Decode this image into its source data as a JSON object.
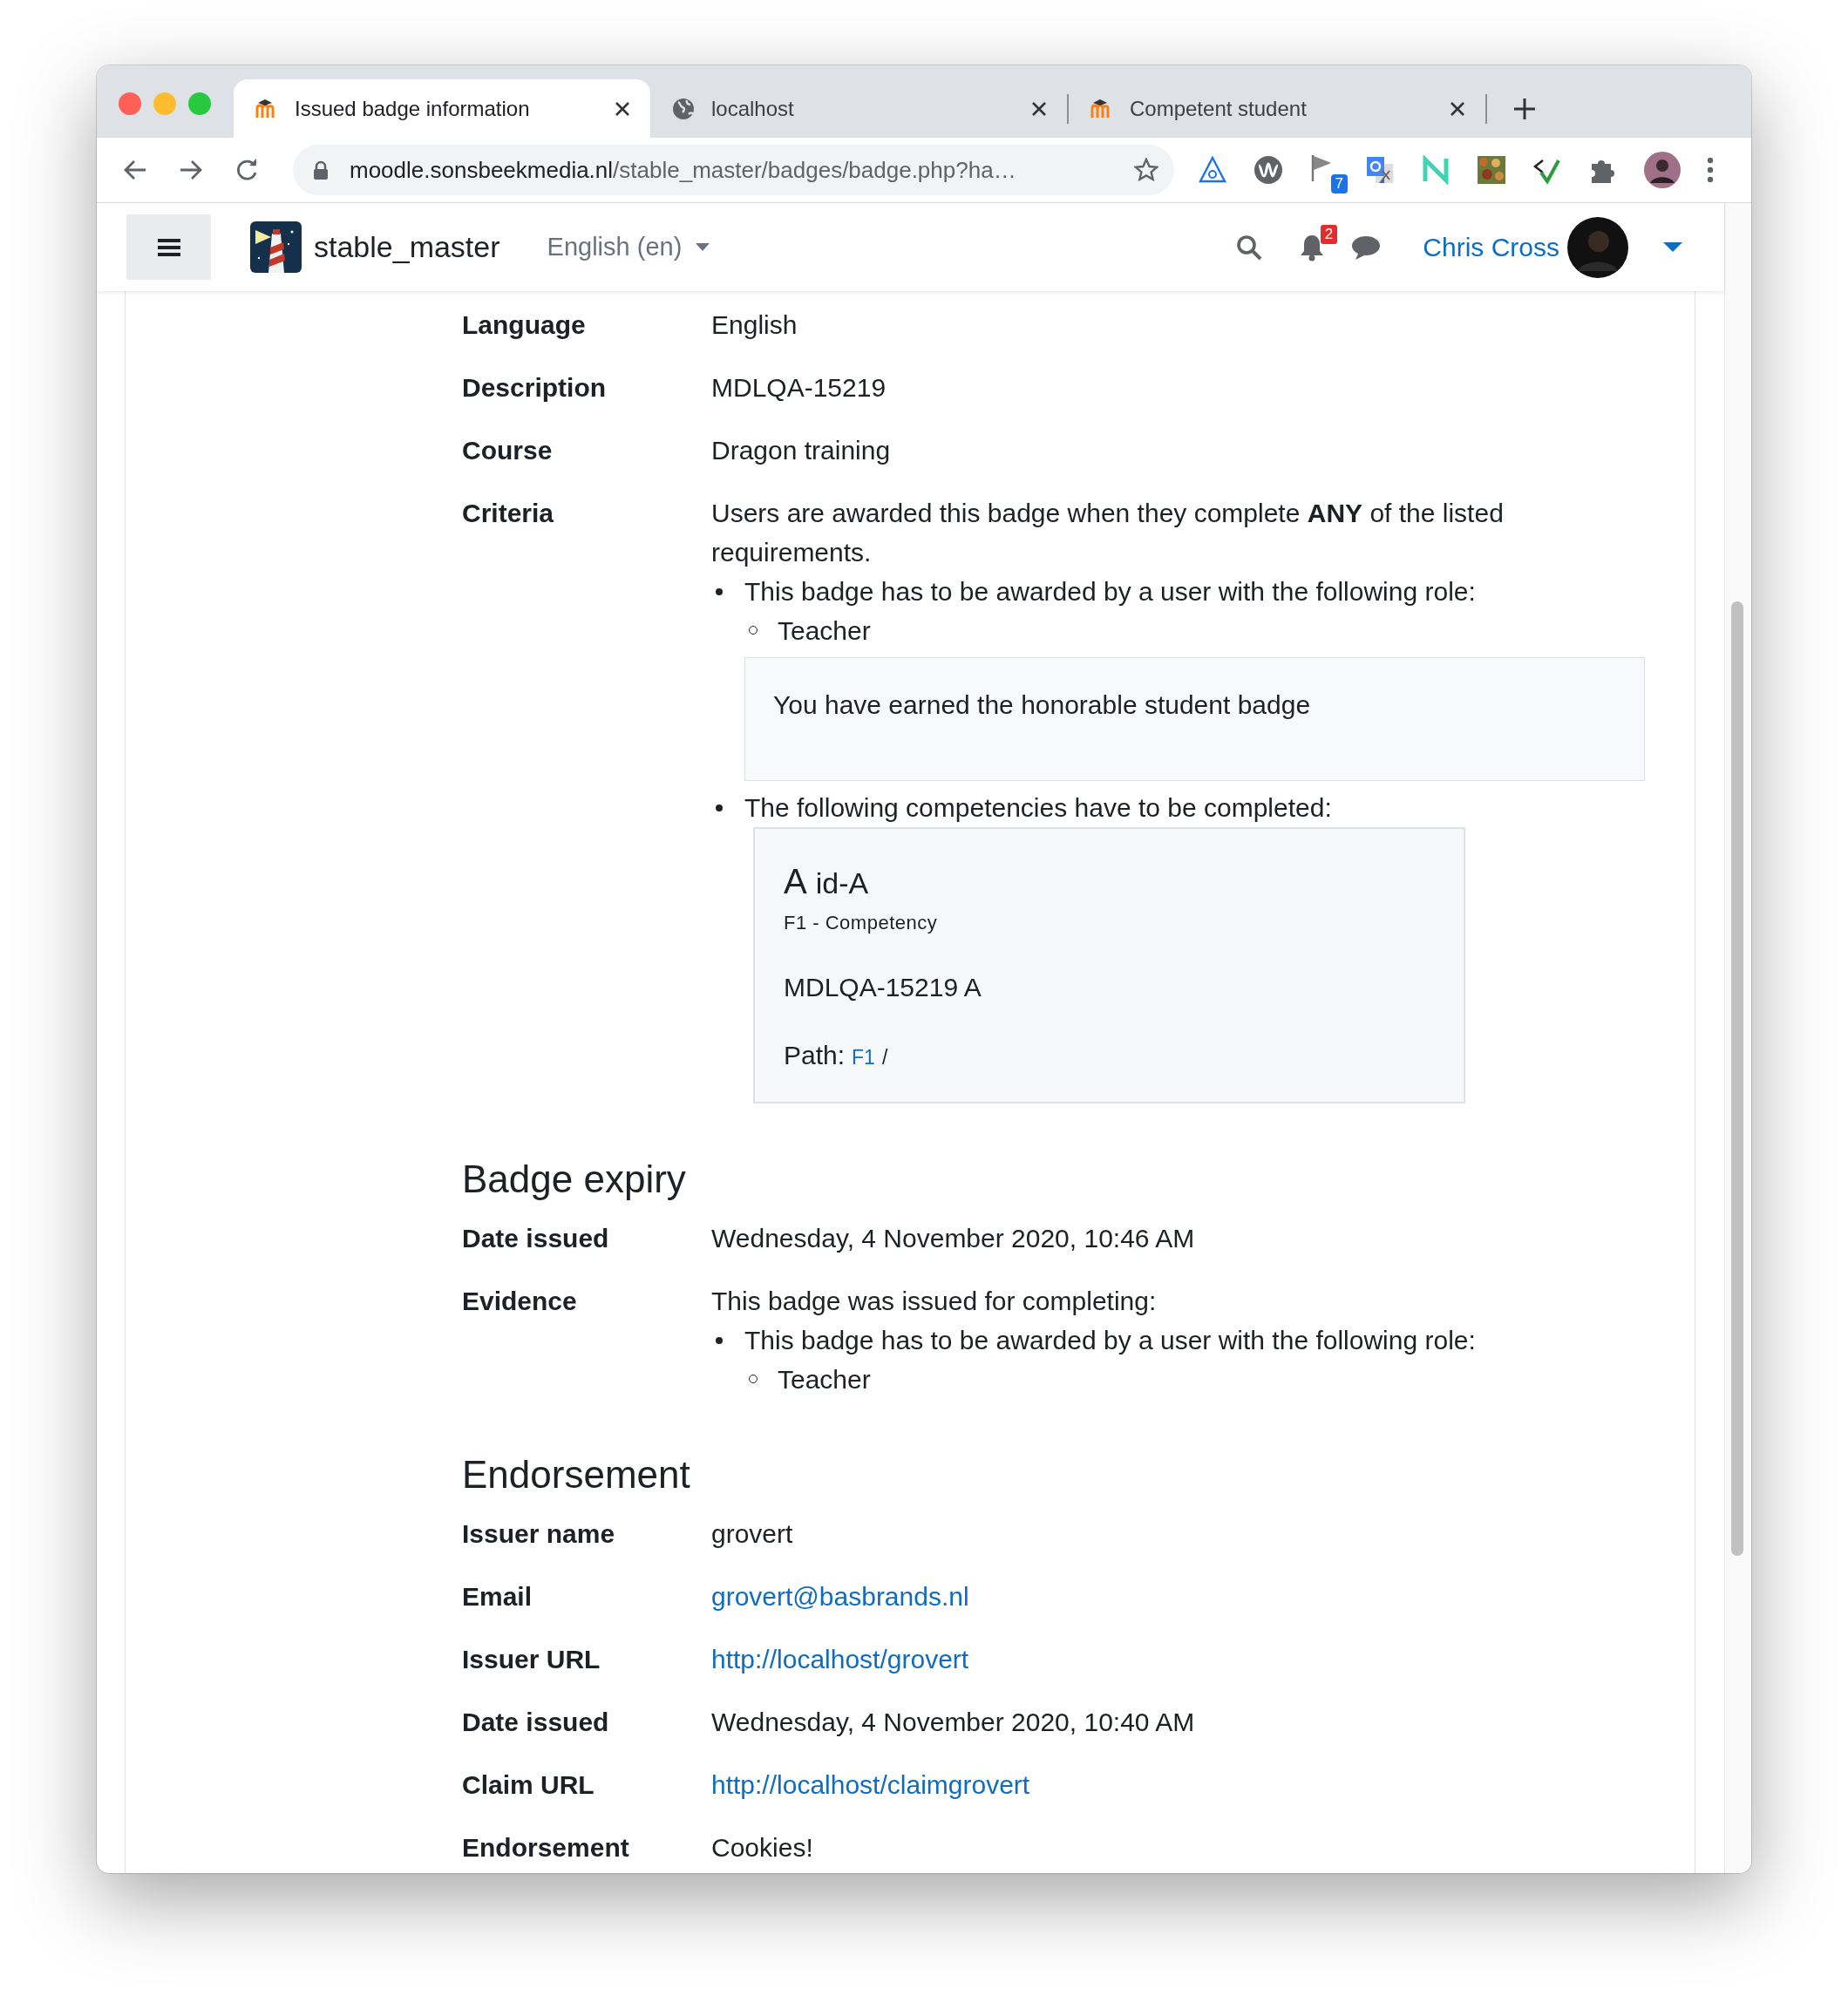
{
  "browser": {
    "tabs": [
      {
        "title": "Issued badge information",
        "kind": "site",
        "selected": true
      },
      {
        "title": "localhost",
        "kind": "web",
        "selected": false
      },
      {
        "title": "Competent student",
        "kind": "site",
        "selected": false
      }
    ],
    "url": {
      "host": "moodle.sonsbeekmedia.nl",
      "path": "/stable_master/badges/badge.php?ha…"
    },
    "extension_badge": "7"
  },
  "navbar": {
    "site_name": "stable_master",
    "language": "English (en)",
    "notification_count": "2",
    "user_name": "Chris Cross"
  },
  "sections": [
    {
      "rows": [
        {
          "label": "Language",
          "kind": "text",
          "value": "English"
        },
        {
          "label": "Description",
          "kind": "text",
          "value": "MDLQA-15219"
        },
        {
          "label": "Course",
          "kind": "text",
          "value": "Dragon training"
        },
        {
          "label": "Criteria",
          "kind": "criteria",
          "intro": "Users are awarded this badge when they complete **ANY** of the listed requirements.",
          "requirements": [
            {
              "text": "This badge has to be awarded by a user with the following role:",
              "roles": [
                "Teacher"
              ],
              "note": "You have earned the honorable student badge"
            },
            {
              "text": "The following competencies have to be completed:",
              "competencies": [
                {
                  "shortname": "A",
                  "idnumber": "id-A",
                  "framework": "F1 - Competency",
                  "description": "MDLQA-15219 A",
                  "path_label": "Path:",
                  "path_link": "F1",
                  "path_separator": "/"
                }
              ]
            }
          ]
        }
      ]
    },
    {
      "heading": "Badge expiry",
      "rows": [
        {
          "label": "Date issued",
          "kind": "text",
          "value": "Wednesday, 4 November 2020, 10:46 AM"
        },
        {
          "label": "Evidence",
          "kind": "criteria",
          "intro": "This badge was issued for completing:",
          "requirements": [
            {
              "text": "This badge has to be awarded by a user with the following role:",
              "roles": [
                "Teacher"
              ]
            }
          ]
        }
      ]
    },
    {
      "heading": "Endorsement",
      "rows": [
        {
          "label": "Issuer name",
          "kind": "text",
          "value": "grovert"
        },
        {
          "label": "Email",
          "kind": "link",
          "value": "grovert@basbrands.nl"
        },
        {
          "label": "Issuer URL",
          "kind": "link",
          "value": "http://localhost/grovert"
        },
        {
          "label": "Date issued",
          "kind": "text",
          "value": "Wednesday, 4 November 2020, 10:40 AM"
        },
        {
          "label": "Claim URL",
          "kind": "link",
          "value": "http://localhost/claimgrovert"
        },
        {
          "label": "Endorsement",
          "kind": "text",
          "value": "Cookies!"
        }
      ]
    }
  ]
}
